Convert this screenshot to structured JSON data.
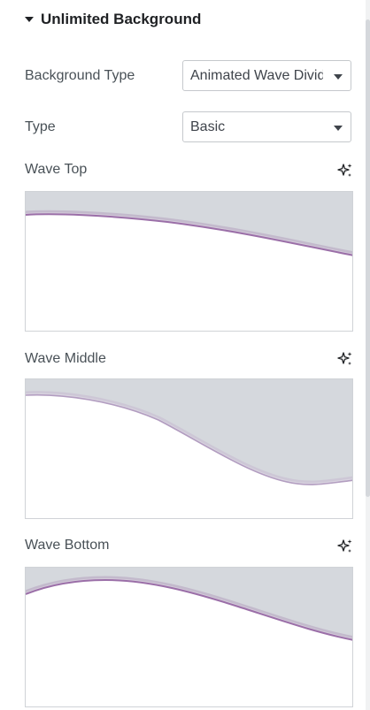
{
  "section": {
    "title": "Unlimited Background"
  },
  "fields": {
    "background_type": {
      "label": "Background Type",
      "value": "Animated Wave Divider"
    },
    "type": {
      "label": "Type",
      "value": "Basic"
    }
  },
  "waves": {
    "top": {
      "label": "Wave Top"
    },
    "middle": {
      "label": "Wave Middle"
    },
    "bottom": {
      "label": "Wave Bottom"
    }
  },
  "icons": {
    "section_toggle": "caret-down-icon",
    "dropdown": "chevron-down-icon",
    "ai": "sparkle-icon"
  },
  "colors": {
    "wave_fill": "#d5d8dd",
    "wave_edge": "#9b6fa8",
    "border": "#c5c8cc",
    "title": "#1f2124",
    "label": "#495157"
  }
}
